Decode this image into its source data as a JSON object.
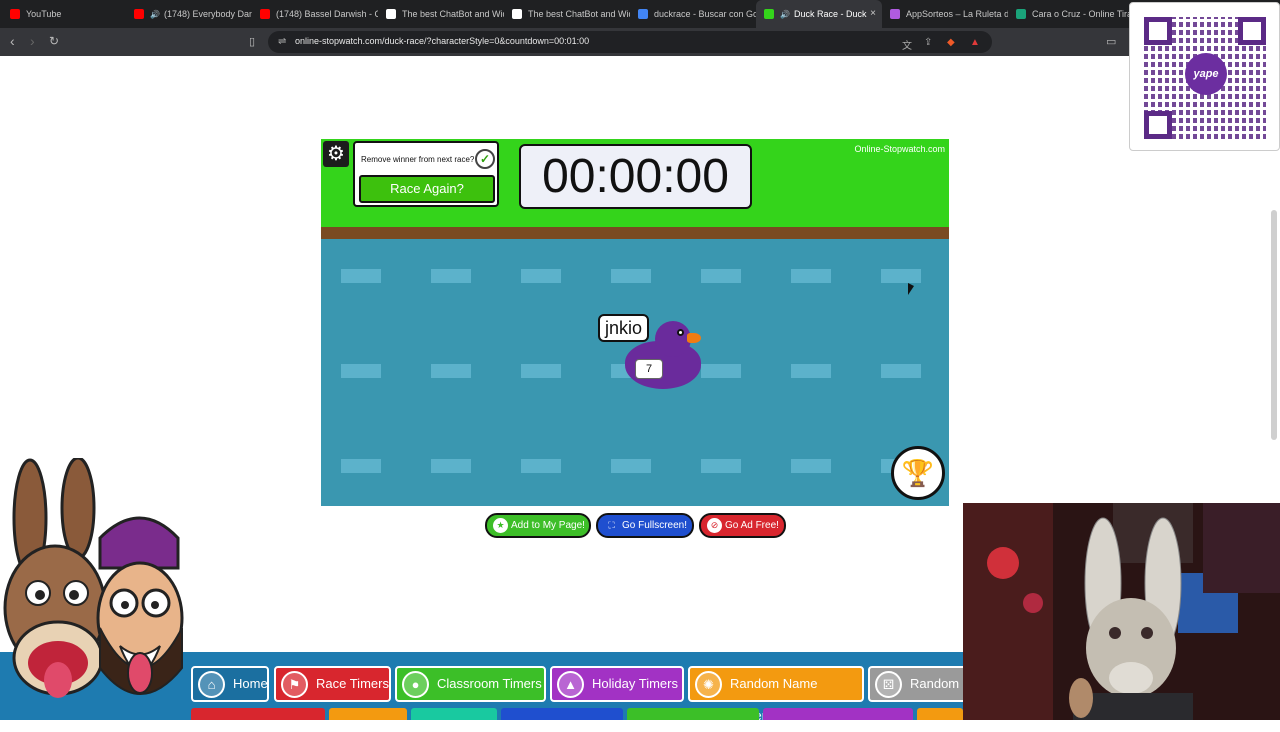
{
  "browser": {
    "tabs": [
      {
        "title": "YouTube",
        "color": "#ff0000",
        "audio": false
      },
      {
        "title": "(1748) Everybody Danc",
        "color": "#ff0000",
        "audio": true
      },
      {
        "title": "(1748) Bassel Darwish - Cr",
        "color": "#ff0000",
        "audio": false
      },
      {
        "title": "The best ChatBot and Wid",
        "color": "#ffffff",
        "audio": false
      },
      {
        "title": "The best ChatBot and Wid",
        "color": "#ffffff",
        "audio": false
      },
      {
        "title": "duckrace - Buscar con Goo",
        "color": "#4285f4",
        "audio": false
      },
      {
        "title": "Duck Race - Duck",
        "color": "#34d41b",
        "audio": true
      },
      {
        "title": "AppSorteos – La Ruleta de",
        "color": "#b05be0",
        "audio": false
      },
      {
        "title": "Cara o Cruz - Online Tirar",
        "color": "#1aa37a",
        "audio": false
      }
    ],
    "tab_close": "×",
    "url": "online-stopwatch.com/duck-race/?characterStyle=0&countdown=00:01:00"
  },
  "qr": {
    "logo_text": "yape"
  },
  "game": {
    "remove_winner_label": "Remove winner from next race?",
    "remove_winner_checked": true,
    "race_again_label": "Race Again?",
    "timer_value": "00:00:00",
    "brand": "Online-Stopwatch.com",
    "duck": {
      "name": "jnkio",
      "number": "7",
      "color": "#6a2b9c"
    }
  },
  "actions": {
    "add_label": "Add to My Page!",
    "fullscreen_label": "Go Fullscreen!",
    "adfree_label": "Go Ad Free!"
  },
  "nav": [
    {
      "label": "Home",
      "color": "#1b6fa0"
    },
    {
      "label": "Race Timers",
      "color": "#d8262e"
    },
    {
      "label": "Classroom Timers",
      "color": "#3cbf28"
    },
    {
      "label": "Holiday Timers",
      "color": "#a232c4"
    },
    {
      "label": "Random Name Pickers",
      "color": "#f39a10"
    },
    {
      "label": "Random N",
      "color": "#9a9a9a"
    }
  ]
}
